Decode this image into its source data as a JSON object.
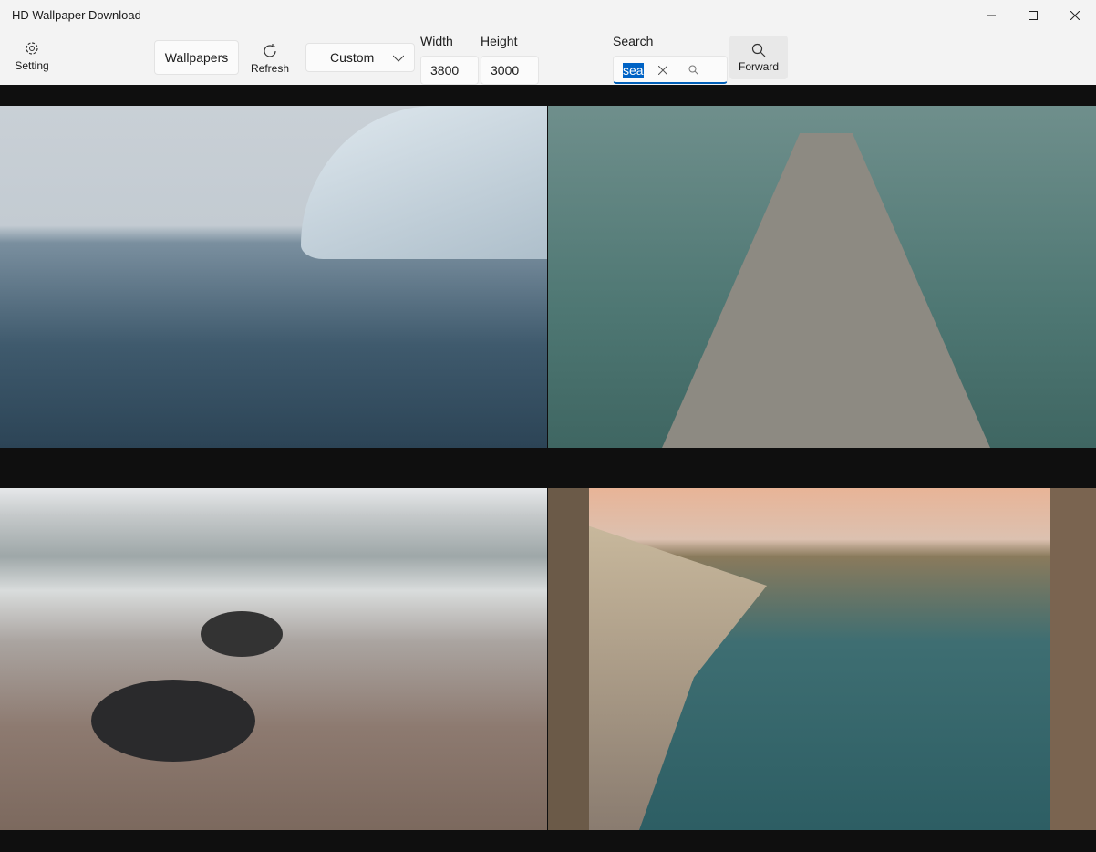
{
  "window": {
    "title": "HD Wallpaper Download"
  },
  "toolbar": {
    "setting_label": "Setting",
    "wallpapers_label": "Wallpapers",
    "refresh_label": "Refresh",
    "size_preset": "Custom",
    "width_label": "Width",
    "width_value": "3800",
    "height_label": "Height",
    "height_value": "3000",
    "search_label": "Search",
    "search_value": "sea",
    "forward_label": "Forward"
  },
  "images": [
    {
      "description_icon": "image-iceberg-sea"
    },
    {
      "description_icon": "image-wooden-pier"
    },
    {
      "description_icon": "image-rocky-beach"
    },
    {
      "description_icon": "image-cliff-coast"
    }
  ]
}
